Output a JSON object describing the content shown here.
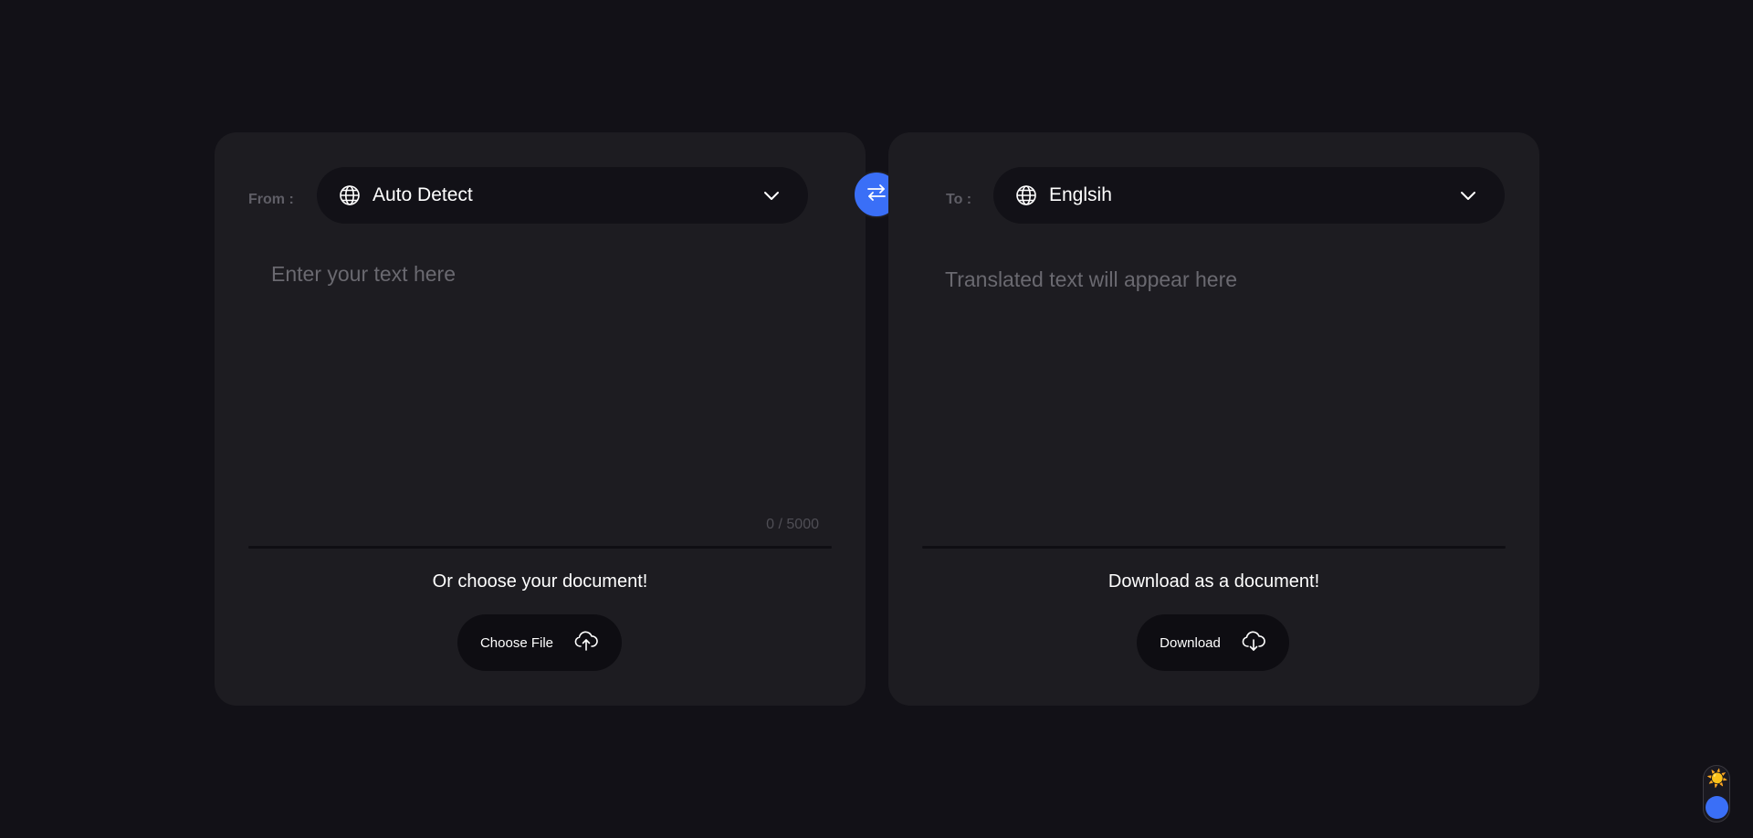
{
  "colors": {
    "background": "#121117",
    "card": "#1d1c21",
    "accent": "#3a6ff7",
    "muted_text": "#6a6970"
  },
  "source": {
    "label": "From :",
    "language": "Auto Detect",
    "language_icon": "globe-icon",
    "dropdown_icon": "chevron-down-icon",
    "placeholder": "Enter your text here",
    "char_count": "0 / 5000",
    "doc_caption": "Or choose your document!",
    "file_button_label": "Choose File",
    "file_button_icon": "cloud-upload-icon"
  },
  "swap": {
    "icon": "swap-arrows-icon"
  },
  "target": {
    "label": "To :",
    "language": "Englsih",
    "language_icon": "globe-icon",
    "dropdown_icon": "chevron-down-icon",
    "placeholder": "Translated text will appear here",
    "doc_caption": "Download as a document!",
    "download_button_label": "Download",
    "download_button_icon": "cloud-download-icon"
  },
  "theme_toggle": {
    "sun_icon": "☀️",
    "state": "dark"
  }
}
